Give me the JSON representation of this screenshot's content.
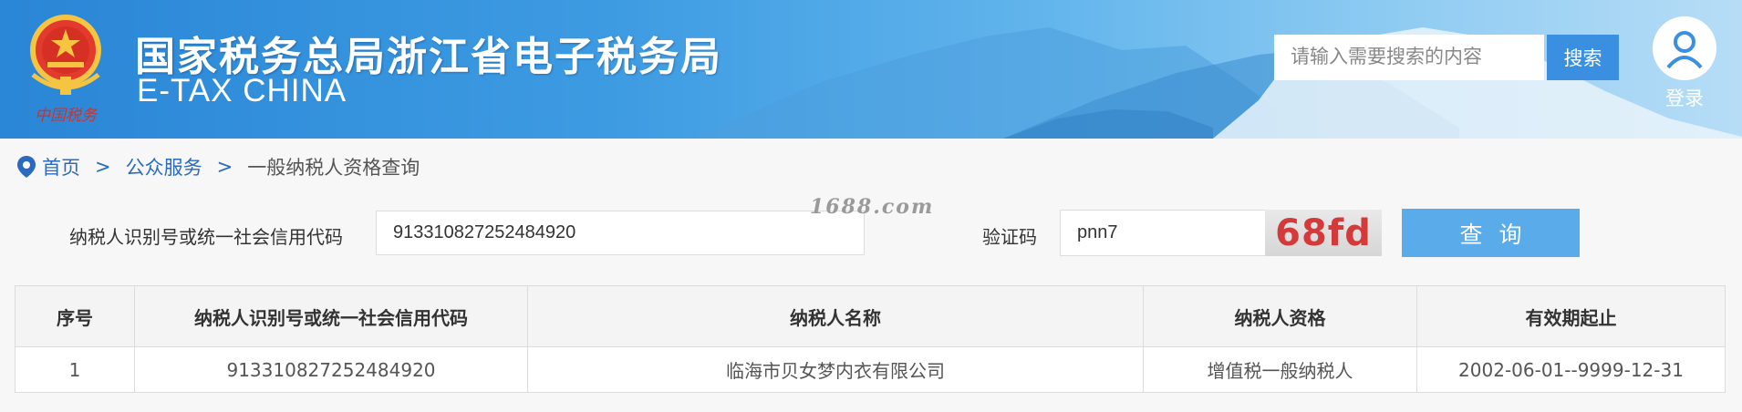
{
  "header": {
    "title_cn": "国家税务总局浙江省电子税务局",
    "title_en": "E-TAX CHINA",
    "emblem_icon": "national-emblem-icon",
    "search": {
      "placeholder": "请输入需要搜索的内容",
      "button_label": "搜索"
    },
    "login_label": "登录"
  },
  "breadcrumb": {
    "icon": "location-pin-icon",
    "items": [
      "首页",
      "公众服务",
      "一般纳税人资格查询"
    ],
    "separator": ">"
  },
  "form": {
    "taxpayer_id_label": "纳税人识别号或统一社会信用代码",
    "taxpayer_id_value": "913310827252484920",
    "captcha_label": "验证码",
    "captcha_value": "pnn7",
    "captcha_image_text": "68fd",
    "query_button_label": "查询"
  },
  "watermark": "1688.com",
  "table": {
    "headers": [
      "序号",
      "纳税人识别号或统一社会信用代码",
      "纳税人名称",
      "纳税人资格",
      "有效期起止"
    ],
    "rows": [
      [
        "1",
        "913310827252484920",
        "临海市贝女梦内衣有限公司",
        "增值税一般纳税人",
        "2002-06-01--9999-12-31"
      ]
    ]
  },
  "colors": {
    "accent": "#3a8fe0",
    "link": "#2a6bbf",
    "query_button": "#5aabe9",
    "captcha_text": "#d43a3a"
  }
}
